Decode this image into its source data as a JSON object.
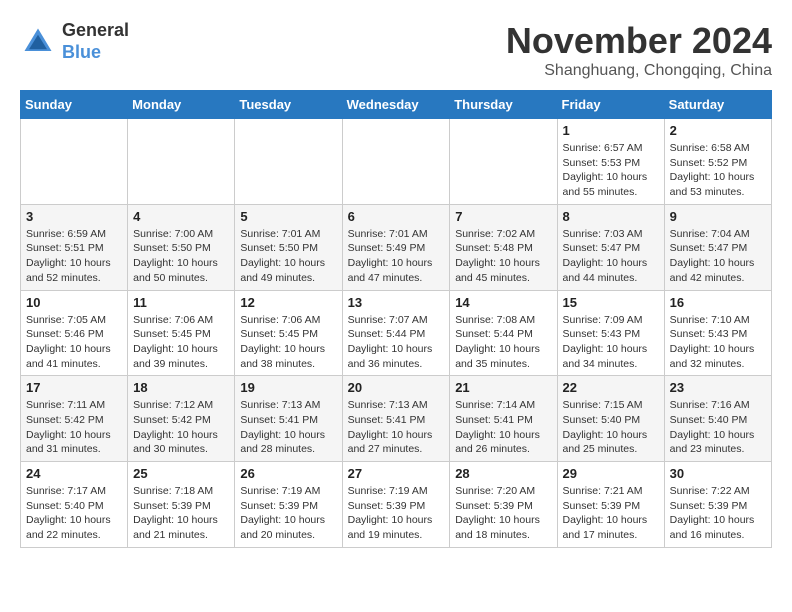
{
  "header": {
    "logo_general": "General",
    "logo_blue": "Blue",
    "month_title": "November 2024",
    "location": "Shanghuang, Chongqing, China"
  },
  "weekdays": [
    "Sunday",
    "Monday",
    "Tuesday",
    "Wednesday",
    "Thursday",
    "Friday",
    "Saturday"
  ],
  "weeks": [
    [
      {
        "day": "",
        "info": ""
      },
      {
        "day": "",
        "info": ""
      },
      {
        "day": "",
        "info": ""
      },
      {
        "day": "",
        "info": ""
      },
      {
        "day": "",
        "info": ""
      },
      {
        "day": "1",
        "info": "Sunrise: 6:57 AM\nSunset: 5:53 PM\nDaylight: 10 hours and 55 minutes."
      },
      {
        "day": "2",
        "info": "Sunrise: 6:58 AM\nSunset: 5:52 PM\nDaylight: 10 hours and 53 minutes."
      }
    ],
    [
      {
        "day": "3",
        "info": "Sunrise: 6:59 AM\nSunset: 5:51 PM\nDaylight: 10 hours and 52 minutes."
      },
      {
        "day": "4",
        "info": "Sunrise: 7:00 AM\nSunset: 5:50 PM\nDaylight: 10 hours and 50 minutes."
      },
      {
        "day": "5",
        "info": "Sunrise: 7:01 AM\nSunset: 5:50 PM\nDaylight: 10 hours and 49 minutes."
      },
      {
        "day": "6",
        "info": "Sunrise: 7:01 AM\nSunset: 5:49 PM\nDaylight: 10 hours and 47 minutes."
      },
      {
        "day": "7",
        "info": "Sunrise: 7:02 AM\nSunset: 5:48 PM\nDaylight: 10 hours and 45 minutes."
      },
      {
        "day": "8",
        "info": "Sunrise: 7:03 AM\nSunset: 5:47 PM\nDaylight: 10 hours and 44 minutes."
      },
      {
        "day": "9",
        "info": "Sunrise: 7:04 AM\nSunset: 5:47 PM\nDaylight: 10 hours and 42 minutes."
      }
    ],
    [
      {
        "day": "10",
        "info": "Sunrise: 7:05 AM\nSunset: 5:46 PM\nDaylight: 10 hours and 41 minutes."
      },
      {
        "day": "11",
        "info": "Sunrise: 7:06 AM\nSunset: 5:45 PM\nDaylight: 10 hours and 39 minutes."
      },
      {
        "day": "12",
        "info": "Sunrise: 7:06 AM\nSunset: 5:45 PM\nDaylight: 10 hours and 38 minutes."
      },
      {
        "day": "13",
        "info": "Sunrise: 7:07 AM\nSunset: 5:44 PM\nDaylight: 10 hours and 36 minutes."
      },
      {
        "day": "14",
        "info": "Sunrise: 7:08 AM\nSunset: 5:44 PM\nDaylight: 10 hours and 35 minutes."
      },
      {
        "day": "15",
        "info": "Sunrise: 7:09 AM\nSunset: 5:43 PM\nDaylight: 10 hours and 34 minutes."
      },
      {
        "day": "16",
        "info": "Sunrise: 7:10 AM\nSunset: 5:43 PM\nDaylight: 10 hours and 32 minutes."
      }
    ],
    [
      {
        "day": "17",
        "info": "Sunrise: 7:11 AM\nSunset: 5:42 PM\nDaylight: 10 hours and 31 minutes."
      },
      {
        "day": "18",
        "info": "Sunrise: 7:12 AM\nSunset: 5:42 PM\nDaylight: 10 hours and 30 minutes."
      },
      {
        "day": "19",
        "info": "Sunrise: 7:13 AM\nSunset: 5:41 PM\nDaylight: 10 hours and 28 minutes."
      },
      {
        "day": "20",
        "info": "Sunrise: 7:13 AM\nSunset: 5:41 PM\nDaylight: 10 hours and 27 minutes."
      },
      {
        "day": "21",
        "info": "Sunrise: 7:14 AM\nSunset: 5:41 PM\nDaylight: 10 hours and 26 minutes."
      },
      {
        "day": "22",
        "info": "Sunrise: 7:15 AM\nSunset: 5:40 PM\nDaylight: 10 hours and 25 minutes."
      },
      {
        "day": "23",
        "info": "Sunrise: 7:16 AM\nSunset: 5:40 PM\nDaylight: 10 hours and 23 minutes."
      }
    ],
    [
      {
        "day": "24",
        "info": "Sunrise: 7:17 AM\nSunset: 5:40 PM\nDaylight: 10 hours and 22 minutes."
      },
      {
        "day": "25",
        "info": "Sunrise: 7:18 AM\nSunset: 5:39 PM\nDaylight: 10 hours and 21 minutes."
      },
      {
        "day": "26",
        "info": "Sunrise: 7:19 AM\nSunset: 5:39 PM\nDaylight: 10 hours and 20 minutes."
      },
      {
        "day": "27",
        "info": "Sunrise: 7:19 AM\nSunset: 5:39 PM\nDaylight: 10 hours and 19 minutes."
      },
      {
        "day": "28",
        "info": "Sunrise: 7:20 AM\nSunset: 5:39 PM\nDaylight: 10 hours and 18 minutes."
      },
      {
        "day": "29",
        "info": "Sunrise: 7:21 AM\nSunset: 5:39 PM\nDaylight: 10 hours and 17 minutes."
      },
      {
        "day": "30",
        "info": "Sunrise: 7:22 AM\nSunset: 5:39 PM\nDaylight: 10 hours and 16 minutes."
      }
    ]
  ]
}
